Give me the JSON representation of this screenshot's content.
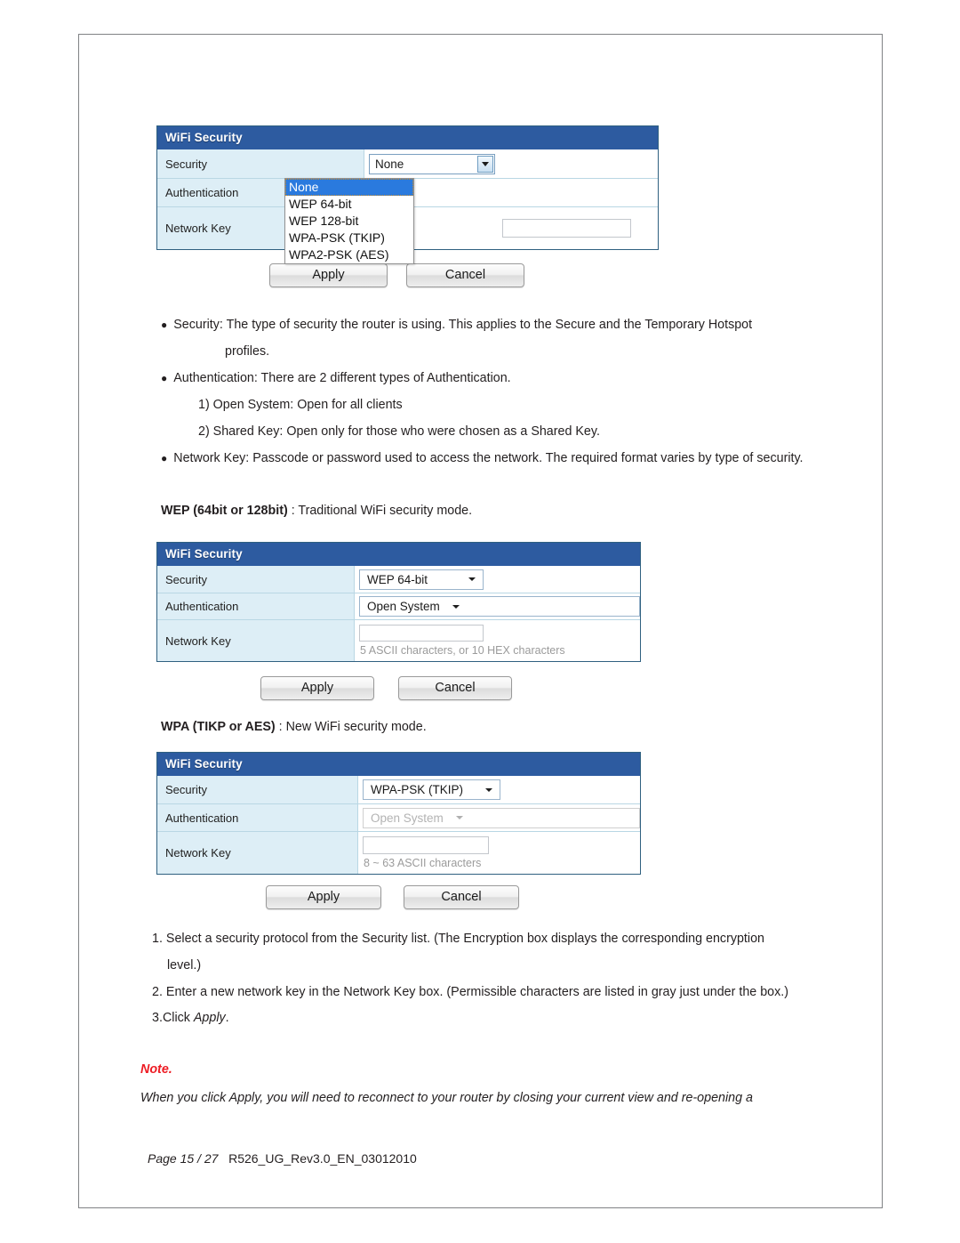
{
  "document": {
    "panels": [
      {
        "id": "panel-none",
        "title": "WiFi Security",
        "rows": [
          {
            "label": "Security",
            "value": "None"
          },
          {
            "label": "Authentication",
            "value": ""
          },
          {
            "label": "Network Key",
            "value": "",
            "hint": ""
          }
        ],
        "dropdown_open": true,
        "dropdown_options": [
          "None",
          "WEP 64-bit",
          "WEP 128-bit",
          "WPA-PSK (TKIP)",
          "WPA2-PSK (AES)"
        ],
        "dropdown_selected": "None",
        "buttons": {
          "apply": "Apply",
          "cancel": "Cancel"
        }
      },
      {
        "id": "panel-wep",
        "title": "WiFi Security",
        "rows": [
          {
            "label": "Security",
            "value": "WEP 64-bit"
          },
          {
            "label": "Authentication",
            "value": "Open System"
          },
          {
            "label": "Network Key",
            "value": "",
            "hint": "5 ASCII characters, or 10 HEX characters"
          }
        ],
        "buttons": {
          "apply": "Apply",
          "cancel": "Cancel"
        }
      },
      {
        "id": "panel-wpa",
        "title": "WiFi Security",
        "rows": [
          {
            "label": "Security",
            "value": "WPA-PSK (TKIP)"
          },
          {
            "label": "Authentication",
            "value": "Open System",
            "disabled": true
          },
          {
            "label": "Network Key",
            "value": "",
            "hint": "8 ~ 63 ASCII characters"
          }
        ],
        "buttons": {
          "apply": "Apply",
          "cancel": "Cancel"
        }
      }
    ],
    "bullets": [
      {
        "text": "Security: The type of security the router is using. This applies to the Secure and the Temporary Hotspot"
      },
      {
        "text": "profiles."
      },
      {
        "text": "Authentication: There are 2 different types of Authentication."
      },
      {
        "text": "1) Open System: Open for all clients"
      },
      {
        "text": "2) Shared Key: Open only for those who were chosen as a Shared Key."
      },
      {
        "text": "Network Key: Passcode or password used to access the network. The required format varies by type of security."
      }
    ],
    "headings": {
      "wep": {
        "bold": "WEP (64bit or 128bit)",
        "rest": " : Traditional WiFi security mode."
      },
      "wpa": {
        "bold": "WPA (TIKP or AES)",
        "rest": " : New WiFi security mode."
      }
    },
    "steps": [
      {
        "num": "1.",
        "text": "Select a security protocol from the Security list. (The Encryption box displays the corresponding encryption"
      },
      {
        "num": "",
        "text": "level.)"
      },
      {
        "num": "2.",
        "text": "Enter a new network key in the Network Key box. (Permissible characters are listed in gray just under the box.)"
      },
      {
        "num": "3.",
        "text": "Click ",
        "emph": "Apply",
        "tail": "."
      }
    ],
    "note": {
      "heading": "Note.",
      "body": "When you click Apply, you will need to reconnect to your router by closing your current view and re-opening a"
    },
    "footer": {
      "page": "Page 15 / 27",
      "revision": "R526_UG_Rev3.0_EN_03012010"
    }
  },
  "colors": {
    "panel_header": "#2d5ba0",
    "row_label_bg": "#ddeef6",
    "note_red": "#ed1c24",
    "dropdown_highlight": "#2a7ade"
  }
}
